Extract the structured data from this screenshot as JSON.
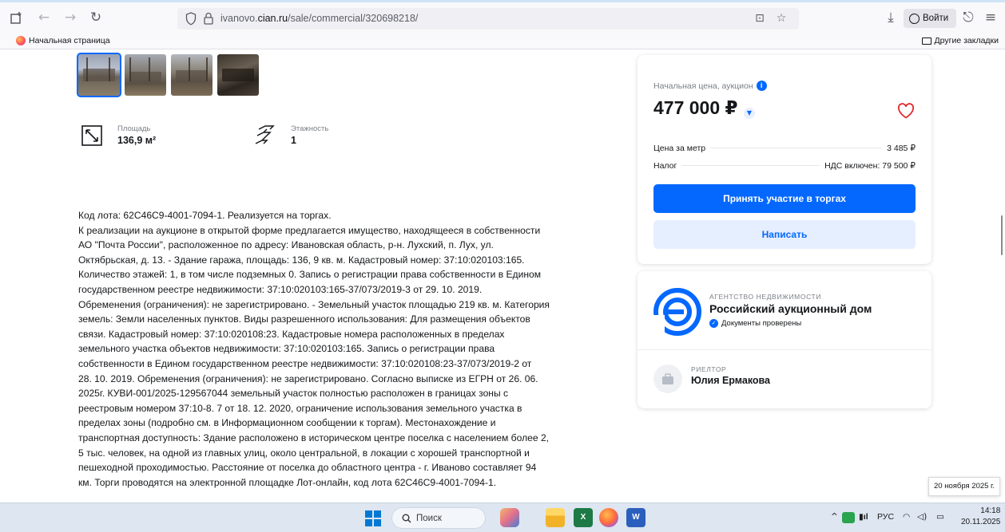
{
  "browser": {
    "url_host_prefix": "ivanovo.",
    "url_host_bold": "cian.ru",
    "url_path": "/sale/commercial/320698218/",
    "signin_label": "Войти",
    "bookmark_home": "Начальная страница",
    "bookmark_other": "Другие закладки"
  },
  "listing": {
    "features": [
      {
        "label": "Площадь",
        "value": "136,9 м²",
        "icon": "area-icon"
      },
      {
        "label": "Этажность",
        "value": "1",
        "icon": "stairs-icon"
      }
    ],
    "description_lines": [
      "Код лота: 62С46С9-4001-7094-1. Реализуется на торгах.",
      "К реализации на аукционе в открытой форме предлагается имущество, находящееся в собственности",
      "АО \"Почта России\", расположенное по адресу: Ивановская область, р-н. Лухский, п. Лух, ул.",
      "Октябрьская, д. 13. - Здание гаража, площадь: 136, 9 кв. м. Кадастровый номер: 37:10:020103:165.",
      "Количество этажей: 1, в том числе подземных 0. Запись о регистрации права собственности в Едином",
      "государственном реестре недвижимости:  37:10:020103:165-37/073/2019-3 от 29. 10. 2019.",
      "Обременения (ограничения): не зарегистрировано. - Земельный участок площадью 219 кв. м. Категория",
      "земель: Земли населенных пунктов. Виды разрешенного использования: Для размещения объектов",
      "связи. Кадастровый номер: 37:10:020108:23. Кадастровые номера расположенных в пределах",
      "земельного участка объектов недвижимости: 37:10:020103:165. Запись о регистрации права",
      "собственности в Едином государственном реестре недвижимости:  37:10:020108:23-37/073/2019-2 от",
      "28. 10. 2019. Обременения (ограничения): не зарегистрировано. Согласно выписке из ЕГРН от 26. 06.",
      "2025г.  КУВИ-001/2025-129567044 земельный участок полностью расположен в границах зоны с",
      "реестровым номером 37:10-8. 7 от 18. 12. 2020, ограничение использования земельного участка в",
      "пределах зоны (подробно см. в Информационном сообщении к торгам). Местонахождение и",
      "транспортная доступность: Здание расположено в историческом центре поселка с населением более 2,",
      "5 тыс. человек, на одной из главных улиц, около центральной, в локации с хорошей транспортной и",
      "пешеходной проходимостью. Расстояние от поселка до областного центра - г. Иваново составляет 94",
      "км.  Торги проводятся на электронной площадке Лот-онлайн, код лота 62С46С9-4001-7094-1."
    ]
  },
  "price_card": {
    "label": "Начальная цена, аукцион",
    "price": "477 000 ₽",
    "per_meter_label": "Цена за метр",
    "per_meter_value": "3 485 ₽",
    "tax_label": "Налог",
    "tax_value": "НДС включен: 79 500 ₽",
    "primary_button": "Принять участие в торгах",
    "secondary_button": "Написать"
  },
  "agency": {
    "type": "АГЕНТСТВО НЕДВИЖИМОСТИ",
    "name": "Российский аукционный дом",
    "verified": "Документы проверены",
    "realtor_type": "РИЕЛТОР",
    "realtor_name": "Юлия Ермакова"
  },
  "tooltip_date": "20 ноября 2025 г.",
  "taskbar": {
    "search_placeholder": "Поиск",
    "lang": "РУС",
    "time": "14:18",
    "date": "20.11.2025"
  },
  "colors": {
    "accent": "#0468ff",
    "accent_light": "#e5efff",
    "heart": "#e3272d"
  }
}
